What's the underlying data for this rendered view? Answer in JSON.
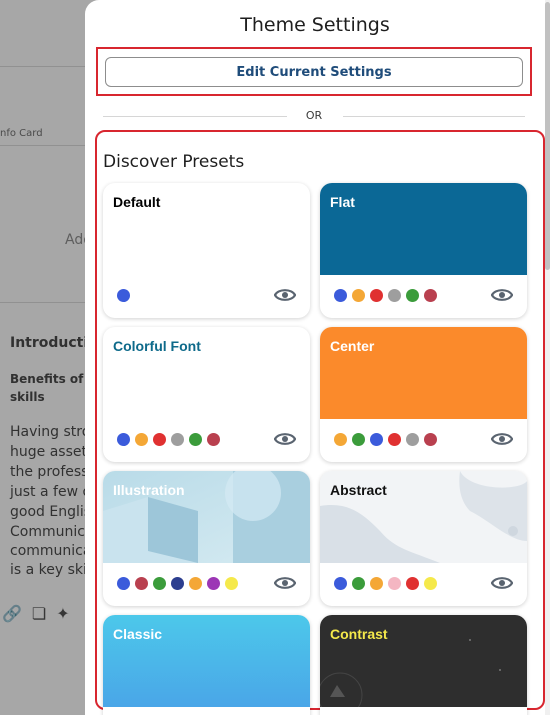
{
  "background": {
    "info_card": "nfo Card",
    "add_text": "Ado",
    "heading": "Introductio",
    "subheading_1": "Benefits of h",
    "subheading_2": "skills",
    "para_lines": [
      "Having stron",
      "huge asset f",
      "the professi",
      "just a few of",
      "good Englis",
      "Communica",
      "communica",
      "is a key skill"
    ]
  },
  "panel": {
    "title": "Theme Settings",
    "edit_button": "Edit Current Settings",
    "or_label": "OR",
    "presets_title": "Discover Presets"
  },
  "presets": [
    {
      "name": "Default",
      "name_color": "#111111",
      "top": "#ffffff",
      "colors": [
        "#3b5bdb"
      ]
    },
    {
      "name": "Flat",
      "name_color": "#ffffff",
      "top": "#0b6896",
      "colors": [
        "#3b5bdb",
        "#f4a736",
        "#e03131",
        "#9e9e9e",
        "#3b9c3b",
        "#b9404f"
      ]
    },
    {
      "name": "Colorful Font",
      "name_color": "#0e6a8a",
      "top": "#ffffff",
      "colors": [
        "#3b5bdb",
        "#f4a736",
        "#e03131",
        "#9e9e9e",
        "#3b9c3b",
        "#b9404f"
      ]
    },
    {
      "name": "Center",
      "name_color": "#ffffff",
      "top": "#fb8a2b",
      "colors": [
        "#f4a736",
        "#3b9c3b",
        "#3b5bdb",
        "#e03131",
        "#9e9e9e",
        "#b9404f"
      ]
    },
    {
      "name": "Illustration",
      "name_color": "#ffffff",
      "top": "illustration",
      "colors": [
        "#3b5bdb",
        "#b9404f",
        "#3b9c3b",
        "#2c3e8f",
        "#f4a736",
        "#9c36b5",
        "#f5e94b"
      ]
    },
    {
      "name": "Abstract",
      "name_color": "#111111",
      "top": "abstract",
      "colors": [
        "#3b5bdb",
        "#3b9c3b",
        "#f4a736",
        "#f4b6c2",
        "#e03131",
        "#f5e94b"
      ]
    },
    {
      "name": "Classic",
      "name_color": "#ffffff",
      "top": "classic",
      "colors": []
    },
    {
      "name": "Contrast",
      "name_color": "#f5e94b",
      "top": "#2e2e2e",
      "colors": []
    }
  ]
}
